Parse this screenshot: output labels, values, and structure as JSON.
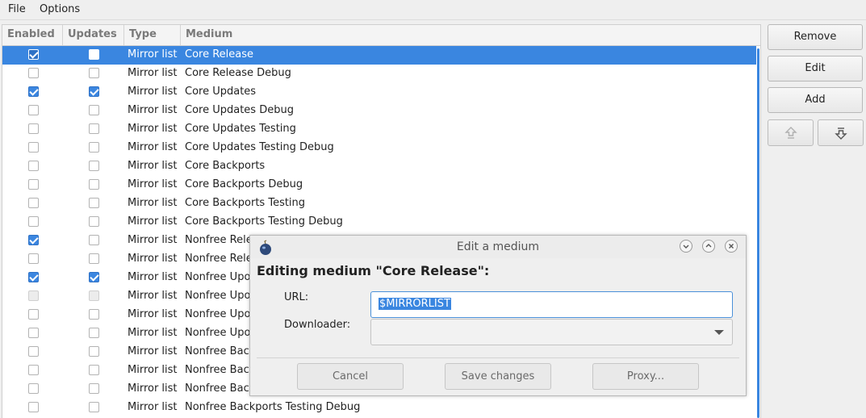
{
  "menu": {
    "file": "File",
    "options": "Options"
  },
  "table": {
    "headers": [
      "Enabled",
      "Updates",
      "Type",
      "Medium"
    ],
    "rows": [
      {
        "enabled": true,
        "updates": false,
        "type": "Mirror list",
        "medium": "Core Release",
        "selected": true
      },
      {
        "enabled": false,
        "updates": false,
        "type": "Mirror list",
        "medium": "Core Release Debug"
      },
      {
        "enabled": true,
        "updates": true,
        "type": "Mirror list",
        "medium": "Core Updates"
      },
      {
        "enabled": false,
        "updates": false,
        "type": "Mirror list",
        "medium": "Core Updates Debug"
      },
      {
        "enabled": false,
        "updates": false,
        "type": "Mirror list",
        "medium": "Core Updates Testing"
      },
      {
        "enabled": false,
        "updates": false,
        "type": "Mirror list",
        "medium": "Core Updates Testing Debug"
      },
      {
        "enabled": false,
        "updates": false,
        "type": "Mirror list",
        "medium": "Core Backports"
      },
      {
        "enabled": false,
        "updates": false,
        "type": "Mirror list",
        "medium": "Core Backports Debug"
      },
      {
        "enabled": false,
        "updates": false,
        "type": "Mirror list",
        "medium": "Core Backports Testing"
      },
      {
        "enabled": false,
        "updates": false,
        "type": "Mirror list",
        "medium": "Core Backports Testing Debug"
      },
      {
        "enabled": true,
        "updates": false,
        "type": "Mirror list",
        "medium": "Nonfree Rele"
      },
      {
        "enabled": false,
        "updates": false,
        "type": "Mirror list",
        "medium": "Nonfree Rele"
      },
      {
        "enabled": true,
        "updates": true,
        "type": "Mirror list",
        "medium": "Nonfree Upo"
      },
      {
        "enabled": false,
        "updates": false,
        "type": "Mirror list",
        "medium": "Nonfree Upo",
        "disabled": true
      },
      {
        "enabled": false,
        "updates": false,
        "type": "Mirror list",
        "medium": "Nonfree Upo"
      },
      {
        "enabled": false,
        "updates": false,
        "type": "Mirror list",
        "medium": "Nonfree Upo"
      },
      {
        "enabled": false,
        "updates": false,
        "type": "Mirror list",
        "medium": "Nonfree Bac"
      },
      {
        "enabled": false,
        "updates": false,
        "type": "Mirror list",
        "medium": "Nonfree Bac"
      },
      {
        "enabled": false,
        "updates": false,
        "type": "Mirror list",
        "medium": "Nonfree Bac"
      },
      {
        "enabled": false,
        "updates": false,
        "type": "Mirror list",
        "medium": "Nonfree Backports Testing Debug"
      }
    ]
  },
  "side_buttons": {
    "remove": "Remove",
    "edit": "Edit",
    "add": "Add"
  },
  "icons": {
    "move_up": "move-up-arrow-icon",
    "move_down": "move-down-arrow-icon",
    "app": "drakrpm-icon"
  },
  "dialog": {
    "title": "Edit a medium",
    "heading": "Editing medium \"Core Release\":",
    "url_label": "URL:",
    "url_value": "$MIRRORLIST",
    "downloader_label": "Downloader:",
    "downloader_value": "",
    "cancel": "Cancel",
    "save": "Save changes",
    "proxy": "Proxy..."
  },
  "colors": {
    "selection": "#3a86e0",
    "accent": "#3b86e0"
  }
}
